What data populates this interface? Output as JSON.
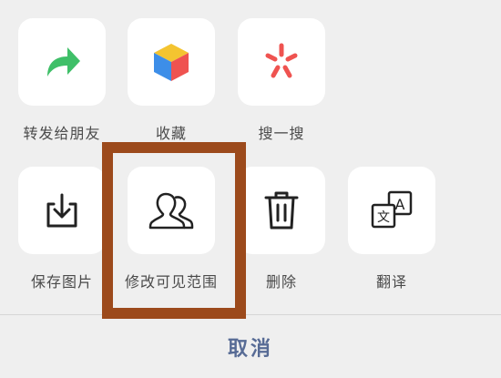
{
  "row1": [
    {
      "label": "转发给朋友",
      "icon": "forward-arrow-icon"
    },
    {
      "label": "收藏",
      "icon": "favorite-cube-icon"
    },
    {
      "label": "搜一搜",
      "icon": "search-sparkle-icon"
    }
  ],
  "row2": [
    {
      "label": "保存图片",
      "icon": "download-save-icon"
    },
    {
      "label": "修改可见范围",
      "icon": "people-visibility-icon"
    },
    {
      "label": "删除",
      "icon": "trash-icon"
    },
    {
      "label": "翻译",
      "icon": "translate-icon"
    }
  ],
  "cancel_label": "取消",
  "colors": {
    "highlight": "#9c4a1c",
    "cancel": "#576b95",
    "forward": "#3fbf68"
  }
}
